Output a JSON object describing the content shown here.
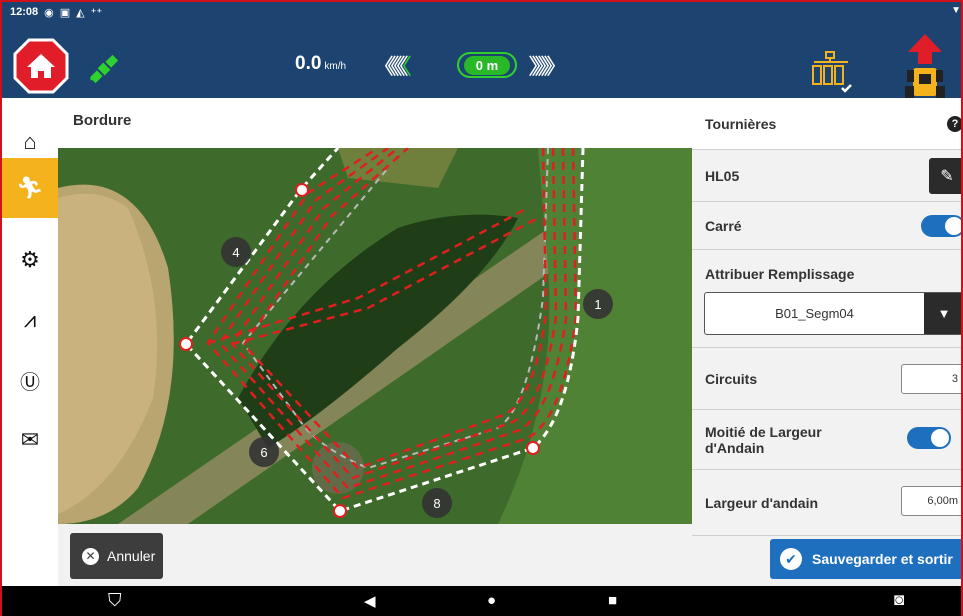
{
  "status_bar": {
    "time": "12:08",
    "icons": [
      "eye-icon",
      "calendar-icon",
      "image-icon",
      "wifi-icon"
    ],
    "right_icon": "signal-triangle-icon"
  },
  "top_bar": {
    "speed_value": "0.0",
    "speed_unit": "km/h",
    "distance": "0 m",
    "icons": [
      "home-stop-icon",
      "gps-satellite-icon",
      "implement-sections-icon",
      "tractor-up-icon"
    ],
    "colors": {
      "bar": "#1d4470",
      "gps": "#2fd12f",
      "home": "#e11d2a",
      "implement": "#f4b31d"
    }
  },
  "sidebar": {
    "items": [
      {
        "icon": "home-icon",
        "active": false
      },
      {
        "icon": "run-icon",
        "active": true
      },
      {
        "icon": "field-settings-icon",
        "active": false
      },
      {
        "icon": "pulse-icon",
        "active": false
      },
      {
        "icon": "ut-icon",
        "active": false
      },
      {
        "icon": "mail-settings-icon",
        "active": false
      }
    ],
    "active_color": "#f4b31d"
  },
  "map": {
    "title": "Bordure",
    "markers": [
      "4",
      "1",
      "6",
      "8"
    ]
  },
  "cancel_button": {
    "label": "Annuler"
  },
  "panel": {
    "title": "Tournières",
    "help": "?",
    "name": "HL05",
    "square_label": "Carré",
    "square_on": true,
    "fill_label": "Attribuer Remplissage",
    "fill_value": "B01_Segm04",
    "circuits_label": "Circuits",
    "circuits_value": "3",
    "half_width_label_1": "Moitié de Largeur",
    "half_width_label_2": "d'Andain",
    "half_width_on": true,
    "swath_label": "Largeur d'andain",
    "swath_value": "6,00m"
  },
  "save_button": {
    "label": "Sauvegarder et sortir"
  },
  "nav_bar": {
    "icons": [
      "app-logo-icon",
      "back-icon",
      "home-dot-icon",
      "recents-icon",
      "camera-icon"
    ]
  }
}
